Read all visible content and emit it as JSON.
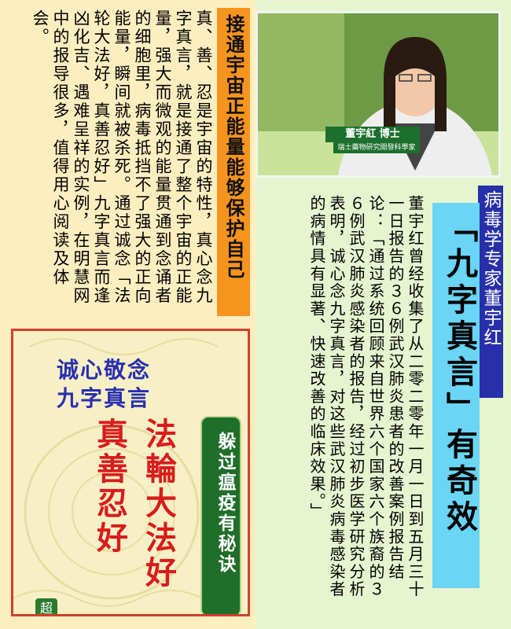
{
  "left_article": {
    "title": "接通宇宙正能量能够保护自己",
    "body": "真、善、忍是宇宙的特性，真心念九字真言，就是接通了整个宇宙的正能量，强大而微观的能量贯通到念诵者的细胞里，病毒抵挡不了强大的正向能量，瞬间就被杀死。通过诚念「法轮大法好，真善忍好」九字真言而逢凶化吉、遇难呈祥的实例，在明慧网中的报导很多，值得用心阅读及体会。"
  },
  "poster": {
    "heading_line1": "诚心敬念",
    "heading_line2": "九字真言",
    "column_right": "法輪大法好",
    "column_left": "真善忍好",
    "scroll_text": "躲过瘟疫有秘诀",
    "badge_text": "超"
  },
  "photo": {
    "caption_name": "董宇紅 博士",
    "caption_sub": "瑞士藥物研究開發科學家"
  },
  "right_article": {
    "header": "病毒学专家董宇红",
    "title": "「九字真言」有奇效",
    "body": "董宇红曾经收集了从二零二零年一月一日到五月三十一日报告的３６例武汉肺炎患者的改善案例报告结论：「通过系统回顾来自世界六个国家六个族裔的３６例武汉肺炎感染者的报告，经过初步医学研究分析表明，诚心念九字真言，对这些武汉肺炎病毒感染者的病情具有显著、快速改善的临床效果。」"
  },
  "colors": {
    "left_bg": "#fdeec0",
    "right_bg": "#e6f5d0",
    "title_orange": "#f7941d",
    "header_blue": "#2730a8",
    "highlight_cyan": "#6ad5f5",
    "poster_red": "#d91c1c",
    "poster_blue": "#2a2fb0",
    "scroll_green": "#1f6e2a"
  }
}
